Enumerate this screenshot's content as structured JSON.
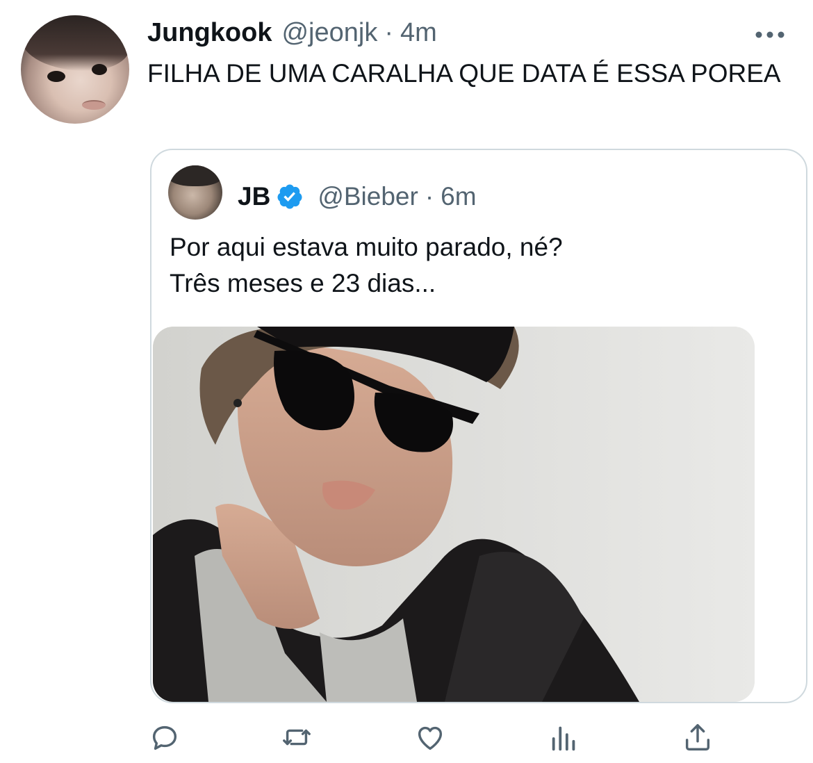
{
  "tweet": {
    "author": {
      "name": "Jungkook",
      "handle": "@jeonjk",
      "avatar_icon": "profile-photo"
    },
    "separator": "·",
    "time": "4m",
    "text": "FILHA DE UMA CARALHA QUE DATA É ESSA POREA",
    "more_icon": "more-horizontal-icon"
  },
  "quote": {
    "author": {
      "name": "JB",
      "handle": "@Bieber",
      "verified": true,
      "verified_color": "#1d9bf0"
    },
    "separator": "·",
    "time": "6m",
    "text_line1": "Por aqui estava muito parado, né?",
    "text_line2": "Três meses e 23 dias..."
  },
  "actions": [
    {
      "icon": "reply-icon"
    },
    {
      "icon": "retweet-icon"
    },
    {
      "icon": "like-icon"
    },
    {
      "icon": "analytics-icon"
    },
    {
      "icon": "share-icon"
    }
  ],
  "colors": {
    "text": "#0f1419",
    "secondary": "#536471",
    "border": "#cfd9de",
    "icon": "#536471"
  }
}
